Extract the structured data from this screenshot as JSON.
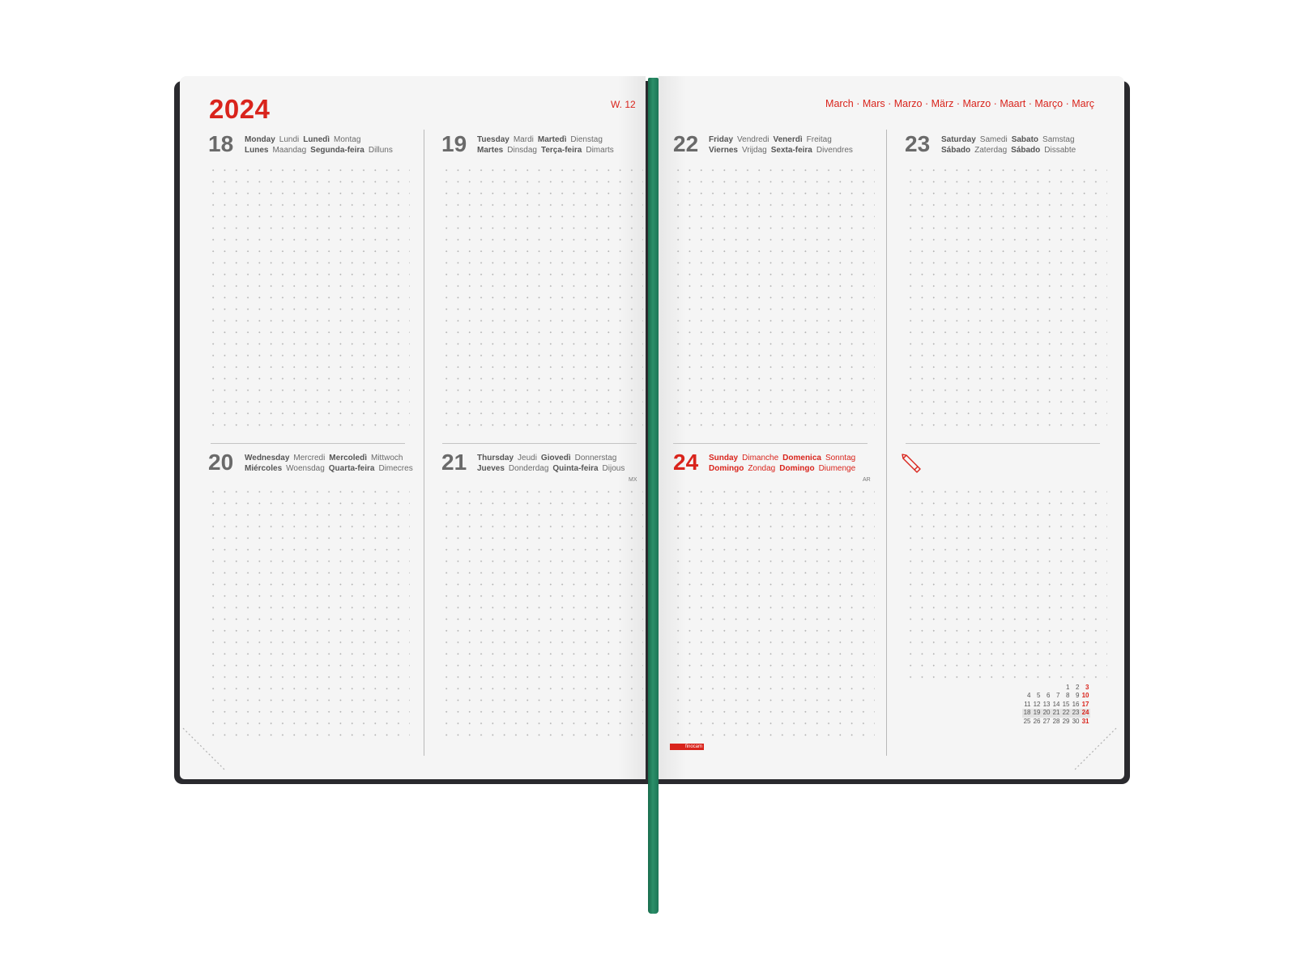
{
  "header": {
    "year": "2024",
    "week": "W. 12",
    "months": "March · Mars · Marzo · März · Marzo · Maart · Março · Març"
  },
  "days": {
    "d18": {
      "num": "18",
      "line1": [
        "Monday",
        "Lundi",
        "Lunedì",
        "Montag"
      ],
      "line2": [
        "Lunes",
        "Maandag",
        "Segunda-feira",
        "Dilluns"
      ]
    },
    "d19": {
      "num": "19",
      "line1": [
        "Tuesday",
        "Mardi",
        "Martedì",
        "Dienstag"
      ],
      "line2": [
        "Martes",
        "Dinsdag",
        "Terça-feira",
        "Dimarts"
      ]
    },
    "d20": {
      "num": "20",
      "line1": [
        "Wednesday",
        "Mercredi",
        "Mercoledì",
        "Mittwoch"
      ],
      "line2": [
        "Miércoles",
        "Woensdag",
        "Quarta-feira",
        "Dimecres"
      ]
    },
    "d21": {
      "num": "21",
      "line1": [
        "Thursday",
        "Jeudi",
        "Giovedì",
        "Donnerstag"
      ],
      "line2": [
        "Jueves",
        "Donderdag",
        "Quinta-feira",
        "Dijous"
      ],
      "tag": "MX"
    },
    "d22": {
      "num": "22",
      "line1": [
        "Friday",
        "Vendredi",
        "Venerdì",
        "Freitag"
      ],
      "line2": [
        "Viernes",
        "Vrijdag",
        "Sexta-feira",
        "Divendres"
      ]
    },
    "d23": {
      "num": "23",
      "line1": [
        "Saturday",
        "Samedi",
        "Sabato",
        "Samstag"
      ],
      "line2": [
        "Sábado",
        "Zaterdag",
        "Sábado",
        "Dissabte"
      ]
    },
    "d24": {
      "num": "24",
      "line1": [
        "Sunday",
        "Dimanche",
        "Domenica",
        "Sonntag"
      ],
      "line2": [
        "Domingo",
        "Zondag",
        "Domingo",
        "Diumenge"
      ],
      "tag": "AR"
    }
  },
  "mini_calendar": {
    "rows": [
      [
        "",
        "",
        "",
        "",
        "1",
        "2",
        "3"
      ],
      [
        "4",
        "5",
        "6",
        "7",
        "8",
        "9",
        "10"
      ],
      [
        "11",
        "12",
        "13",
        "14",
        "15",
        "16",
        "17"
      ],
      [
        "18",
        "19",
        "20",
        "21",
        "22",
        "23",
        "24"
      ],
      [
        "25",
        "26",
        "27",
        "28",
        "29",
        "30",
        "31"
      ]
    ],
    "current_row": 3
  },
  "brand": {
    "name": "finocam"
  },
  "notes_icon": "pencil-icon",
  "colors": {
    "accent_red": "#d9241c",
    "ribbon_green": "#2b8f69",
    "cover_dark": "#2a2a2e",
    "page": "#f5f5f5"
  }
}
